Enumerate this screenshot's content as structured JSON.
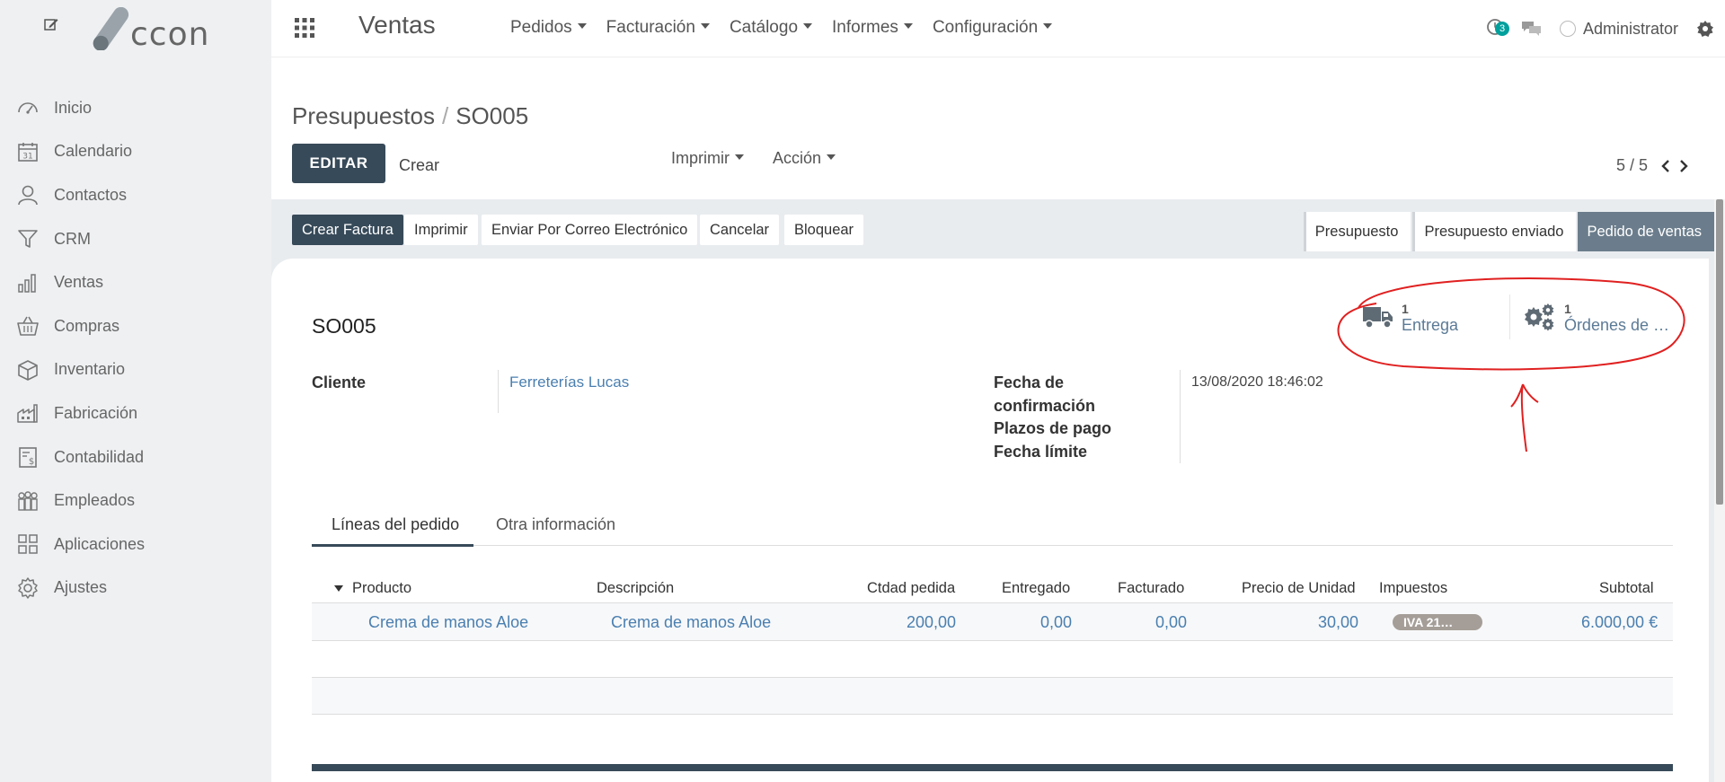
{
  "brand": {
    "logo_text": "ccon"
  },
  "sidebar": {
    "items": [
      {
        "label": "Inicio",
        "icon": "dashboard-icon"
      },
      {
        "label": "Calendario",
        "icon": "calendar-icon"
      },
      {
        "label": "Contactos",
        "icon": "user-icon"
      },
      {
        "label": "CRM",
        "icon": "filter-icon"
      },
      {
        "label": "Ventas",
        "icon": "bar-chart-icon"
      },
      {
        "label": "Compras",
        "icon": "basket-icon"
      },
      {
        "label": "Inventario",
        "icon": "box-icon"
      },
      {
        "label": "Fabricación",
        "icon": "factory-icon"
      },
      {
        "label": "Contabilidad",
        "icon": "ledger-icon"
      },
      {
        "label": "Empleados",
        "icon": "people-icon"
      },
      {
        "label": "Aplicaciones",
        "icon": "apps-grid-icon"
      },
      {
        "label": "Ajustes",
        "icon": "gear-icon"
      }
    ]
  },
  "topbar": {
    "app_title": "Ventas",
    "menus": [
      "Pedidos",
      "Facturación",
      "Catálogo",
      "Informes",
      "Configuración"
    ],
    "badge_count": "3",
    "user": "Administrator"
  },
  "control": {
    "breadcrumb_parent": "Presupuestos",
    "breadcrumb_current": "SO005",
    "edit_label": "EDITAR",
    "create_label": "Crear",
    "print_label": "Imprimir",
    "action_label": "Acción",
    "pager": "5 / 5"
  },
  "statusbar": {
    "buttons": [
      "Crear Factura",
      "Imprimir",
      "Enviar Por Correo Electrónico",
      "Cancelar",
      "Bloquear"
    ],
    "stages": [
      "Presupuesto",
      "Presupuesto enviado",
      "Pedido de ventas"
    ],
    "active_stage": "Pedido de ventas"
  },
  "form": {
    "name": "SO005",
    "smart_buttons": [
      {
        "count": "1",
        "label": "Entrega",
        "icon": "truck-icon"
      },
      {
        "count": "1",
        "label": "Órdenes de …",
        "icon": "gears-icon"
      }
    ],
    "client_label": "Cliente",
    "client_value": "Ferreterías Lucas",
    "confirm_label_1": "Fecha de",
    "confirm_label_2": "confirmación",
    "confirm_value": "13/08/2020 18:46:02",
    "payment_terms_label": "Plazos de pago",
    "deadline_label": "Fecha límite"
  },
  "tabs": [
    "Líneas del pedido",
    "Otra información"
  ],
  "table": {
    "headers": [
      "Producto",
      "Descripción",
      "Ctdad pedida",
      "Entregado",
      "Facturado",
      "Precio de Unidad",
      "Impuestos",
      "Subtotal"
    ],
    "rows": [
      {
        "product": "Crema de manos Aloe",
        "description": "Crema de manos Aloe",
        "qty": "200,00",
        "delivered": "0,00",
        "invoiced": "0,00",
        "unit_price": "30,00",
        "tax": "IVA 21…",
        "subtotal": "6.000,00 €"
      }
    ]
  },
  "colors": {
    "primary": "#374a59",
    "link": "#4a7fb0",
    "badge": "#00a09d",
    "annotation": "#e02020"
  }
}
